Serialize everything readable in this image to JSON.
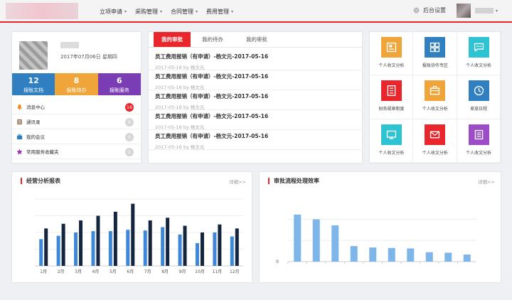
{
  "header": {
    "menu": [
      {
        "label": "立项申请"
      },
      {
        "label": "采购管理"
      },
      {
        "label": "合同管理"
      },
      {
        "label": "费用管理"
      }
    ],
    "caret": "▾",
    "settings_label": "后台设置"
  },
  "profile": {
    "date": "2017年07月06日 星期四",
    "stats": [
      {
        "value": "12",
        "label": "报账文档",
        "color": "#2f7fc1"
      },
      {
        "value": "8",
        "label": "报账待办",
        "color": "#f0a53a"
      },
      {
        "value": "6",
        "label": "报账服务",
        "color": "#7b3db4"
      }
    ],
    "items": [
      {
        "label": "消息中心",
        "count": "16",
        "icon": "bell-icon",
        "color": "#f08a24",
        "badge_color": "#e8262b"
      },
      {
        "label": "通讯录",
        "count": "0",
        "icon": "address-book-icon",
        "color": "#8a6a4a",
        "badge_color": "#d6d6d6"
      },
      {
        "label": "我的会议",
        "count": "0",
        "icon": "briefcase-icon",
        "color": "#2f7fc1",
        "badge_color": "#d6d6d6"
      },
      {
        "label": "常用服务收藏夹",
        "count": "0",
        "icon": "star-icon",
        "color": "#9c27b0",
        "badge_color": "#d6d6d6"
      }
    ]
  },
  "approvals": {
    "tabs": [
      {
        "label": "我的审批"
      },
      {
        "label": "我的待办"
      },
      {
        "label": "我的审批"
      }
    ],
    "items": [
      {
        "title": "员工费用报销（有申请）-杨文元-2017-05-16",
        "meta": "2017-05-16 by 杨文元"
      },
      {
        "title": "员工费用报销（有申请）-杨文元-2017-05-16",
        "meta": "2017-05-16 by 杨文元"
      },
      {
        "title": "员工费用报销（有申请）-杨文元-2017-05-16",
        "meta": "2017-05-16 by 杨文元"
      },
      {
        "title": "员工费用报销（有申请）-杨文元-2017-05-16",
        "meta": "2017-05-16 by 杨文元"
      },
      {
        "title": "员工费用报销（有申请）-杨文元-2017-05-16",
        "meta": "2017-05-16 by 杨文元"
      }
    ]
  },
  "apps": [
    {
      "label": "个人收文分析",
      "icon": "newspaper-icon",
      "color": "#f0a53a"
    },
    {
      "label": "报账协作专区",
      "icon": "grid-icon",
      "color": "#2f7fc1"
    },
    {
      "label": "个人收文分析",
      "icon": "chat-icon",
      "color": "#2ec3d3"
    },
    {
      "label": "财务规章制度",
      "icon": "document-icon",
      "color": "#e8262b"
    },
    {
      "label": "个人收文分析",
      "icon": "briefcase-icon",
      "color": "#f0a53a"
    },
    {
      "label": "差旅日程",
      "icon": "clock-icon",
      "color": "#2f7fc1"
    },
    {
      "label": "个人收文分析",
      "icon": "monitor-icon",
      "color": "#2ec3d3"
    },
    {
      "label": "个人收文分析",
      "icon": "mail-icon",
      "color": "#e8262b"
    },
    {
      "label": "个人收文分析",
      "icon": "list-icon",
      "color": "#9c4cc6"
    }
  ],
  "chart_data": [
    {
      "type": "bar",
      "title": "经营分析报表",
      "detail_label": "详细>>",
      "categories": [
        "1月",
        "2月",
        "3月",
        "4月",
        "5月",
        "6月",
        "7月",
        "8月",
        "9月",
        "10月",
        "11月",
        "12月"
      ],
      "series": [
        {
          "values": [
            40,
            45,
            50,
            52,
            52,
            54,
            53,
            58,
            47,
            34,
            50,
            44
          ],
          "color": "#3f87d8"
        },
        {
          "values": [
            56,
            63,
            68,
            75,
            81,
            93,
            68,
            72,
            60,
            50,
            62,
            56
          ],
          "color": "#14253f"
        }
      ],
      "ylim": [
        0,
        100
      ],
      "grid": true
    },
    {
      "type": "bar",
      "title": "审批流程处理效率",
      "detail_label": "详细>>",
      "categories": [
        "",
        "",
        "",
        "",
        "",
        "",
        "",
        "",
        "",
        ""
      ],
      "series": [
        {
          "values": [
            100,
            90,
            77,
            33,
            30,
            29,
            28,
            20,
            19,
            15
          ],
          "color": "#7fb6ea"
        }
      ],
      "ytick_labels": [
        "0"
      ],
      "ylim": [
        0,
        130
      ],
      "grid": true
    }
  ]
}
